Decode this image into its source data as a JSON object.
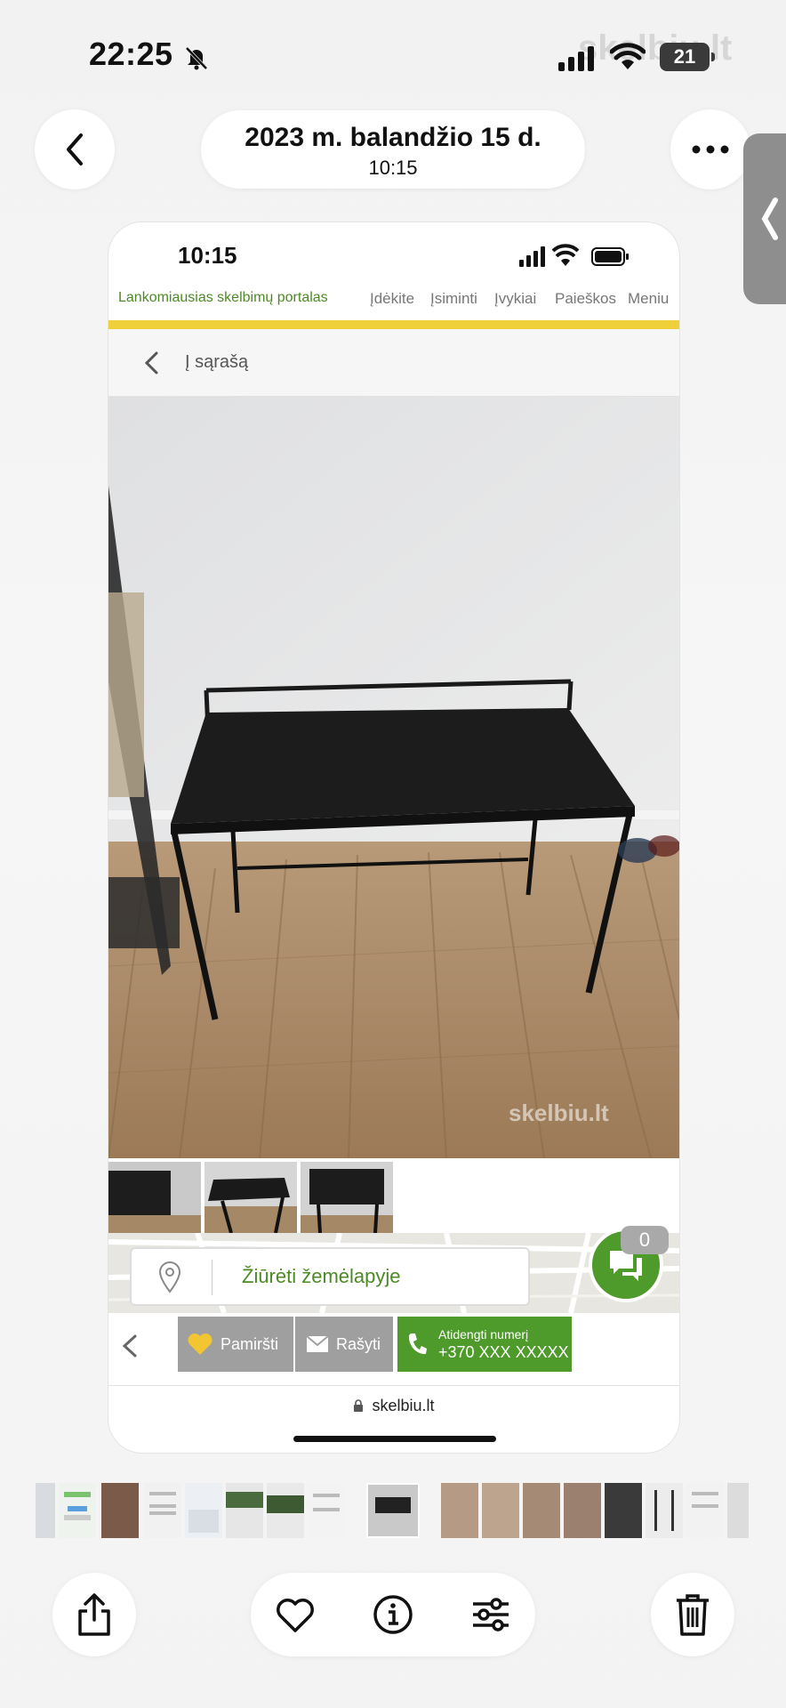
{
  "status_bar": {
    "time": "22:25",
    "battery": "21"
  },
  "watermark_top": "skelbiu.lt",
  "header": {
    "date": "2023 m. balandžio 15 d.",
    "time": "10:15"
  },
  "inner": {
    "time": "10:15",
    "brand": "Lankomiausias skelbimų portalas",
    "nav": [
      "Įdėkite",
      "Įsiminti",
      "Įvykiai",
      "Paieškos",
      "Meniu"
    ],
    "back_label": "Į sąrašą",
    "photo_watermark": "skelbiu.lt",
    "map_label": "Žiūrėti žemėlapyje",
    "chat_count": "0",
    "actions": {
      "forget": "Pamiršti",
      "write": "Rašyti",
      "phone_title": "Atidengti numerį",
      "phone_number": "+370 XXX XXXXX"
    },
    "url": "skelbiu.lt"
  },
  "colors": {
    "brand_green": "#4e9a2a",
    "accent_yellow": "#f0d03a",
    "button_grey": "#9f9f9f"
  },
  "toolbar_icons": [
    "share-icon",
    "heart-icon",
    "info-icon",
    "sliders-icon",
    "trash-icon"
  ]
}
